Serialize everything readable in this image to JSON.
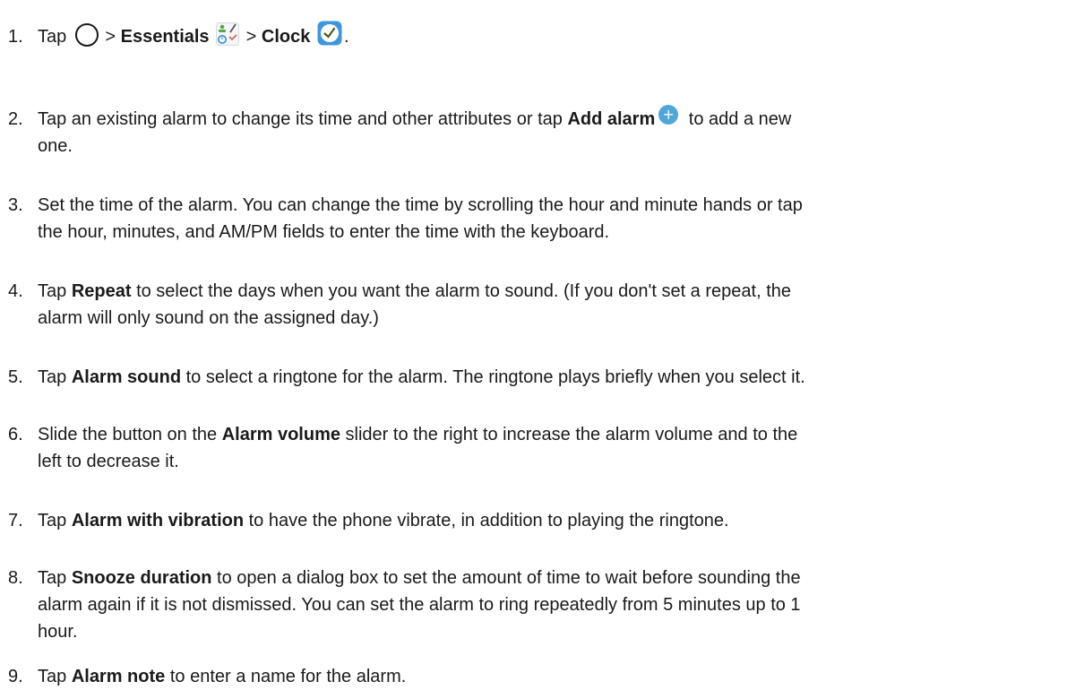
{
  "steps": [
    {
      "num": "1.",
      "lines": [
        [
          "Tap ",
          "",
          " > ",
          "Essentials",
          " ",
          "",
          " > ",
          "Clock",
          " ",
          "",
          "."
        ]
      ]
    },
    {
      "num": "2.",
      "l1a": "Tap an existing alarm to change its time and other attributes or tap ",
      "l1b": "Add alarm",
      "l1c": " to add a new",
      "l2": "one."
    },
    {
      "num": "3.",
      "l1": "Set the time of the alarm. You can change the time by scrolling the hour and minute hands or tap",
      "l2": "the hour, minutes, and AM/PM fields to enter the time with the keyboard."
    },
    {
      "num": "4.",
      "l1a": "Tap ",
      "l1b": "Repeat",
      "l1c": " to select the days when you want the alarm to sound. (If you don't set a repeat, the",
      "l2": "alarm will only sound on the assigned day.)"
    },
    {
      "num": "5.",
      "l1a": "Tap ",
      "l1b": "Alarm sound",
      "l1c": " to select a ringtone for the alarm. The ringtone plays briefly when you select it."
    },
    {
      "num": "6.",
      "l1a": "Slide the button on the ",
      "l1b": "Alarm volume",
      "l1c": " slider to the right to increase the alarm volume and to the",
      "l2": "left to decrease it."
    },
    {
      "num": "7.",
      "l1a": "Tap ",
      "l1b": "Alarm with vibration",
      "l1c": " to have the phone vibrate, in addition to playing the ringtone."
    },
    {
      "num": "8.",
      "l1a": "Tap ",
      "l1b": "Snooze duration",
      "l1c": " to open a dialog box to set the amount of time to wait before sounding the",
      "l2": "alarm again if it is not dismissed. You can set the alarm to ring repeatedly from 5 minutes up to 1",
      "l3": "hour."
    },
    {
      "num": "9.",
      "l1a": "Tap ",
      "l1b": "Alarm note",
      "l1c": " to enter a name for the alarm."
    }
  ],
  "step1": {
    "tap": "Tap ",
    "sep": " > ",
    "essentials": "Essentials",
    "clock": "Clock",
    "end": "."
  },
  "icons": {
    "home": "home-circle-icon",
    "essentials": "essentials-folder-icon",
    "clock": "clock-app-icon",
    "add": "add-plus-icon",
    "add_color": "#4fa6d8"
  }
}
